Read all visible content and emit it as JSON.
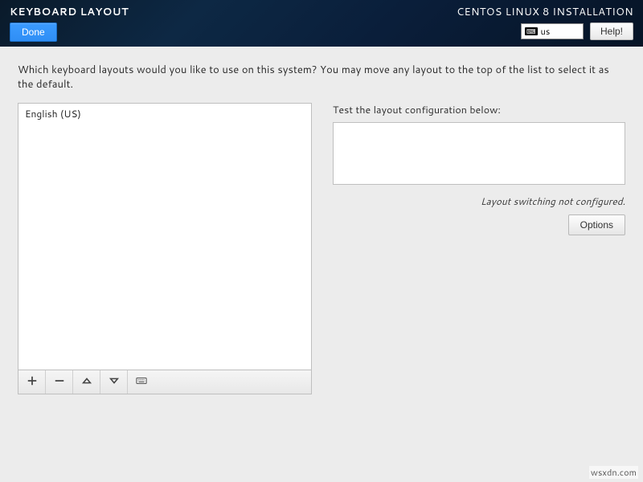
{
  "header": {
    "page_title": "KEYBOARD LAYOUT",
    "install_title": "CENTOS LINUX 8 INSTALLATION",
    "done_label": "Done",
    "help_label": "Help!",
    "lang_code": "us"
  },
  "instruction": "Which keyboard layouts would you like to use on this system?  You may move any layout to the top of the list to select it as the default.",
  "layouts": {
    "items": [
      {
        "label": "English (US)"
      }
    ]
  },
  "test": {
    "label": "Test the layout configuration below:",
    "value": ""
  },
  "switch_status": "Layout switching not configured.",
  "options_label": "Options",
  "watermark": "wsxdn.com"
}
